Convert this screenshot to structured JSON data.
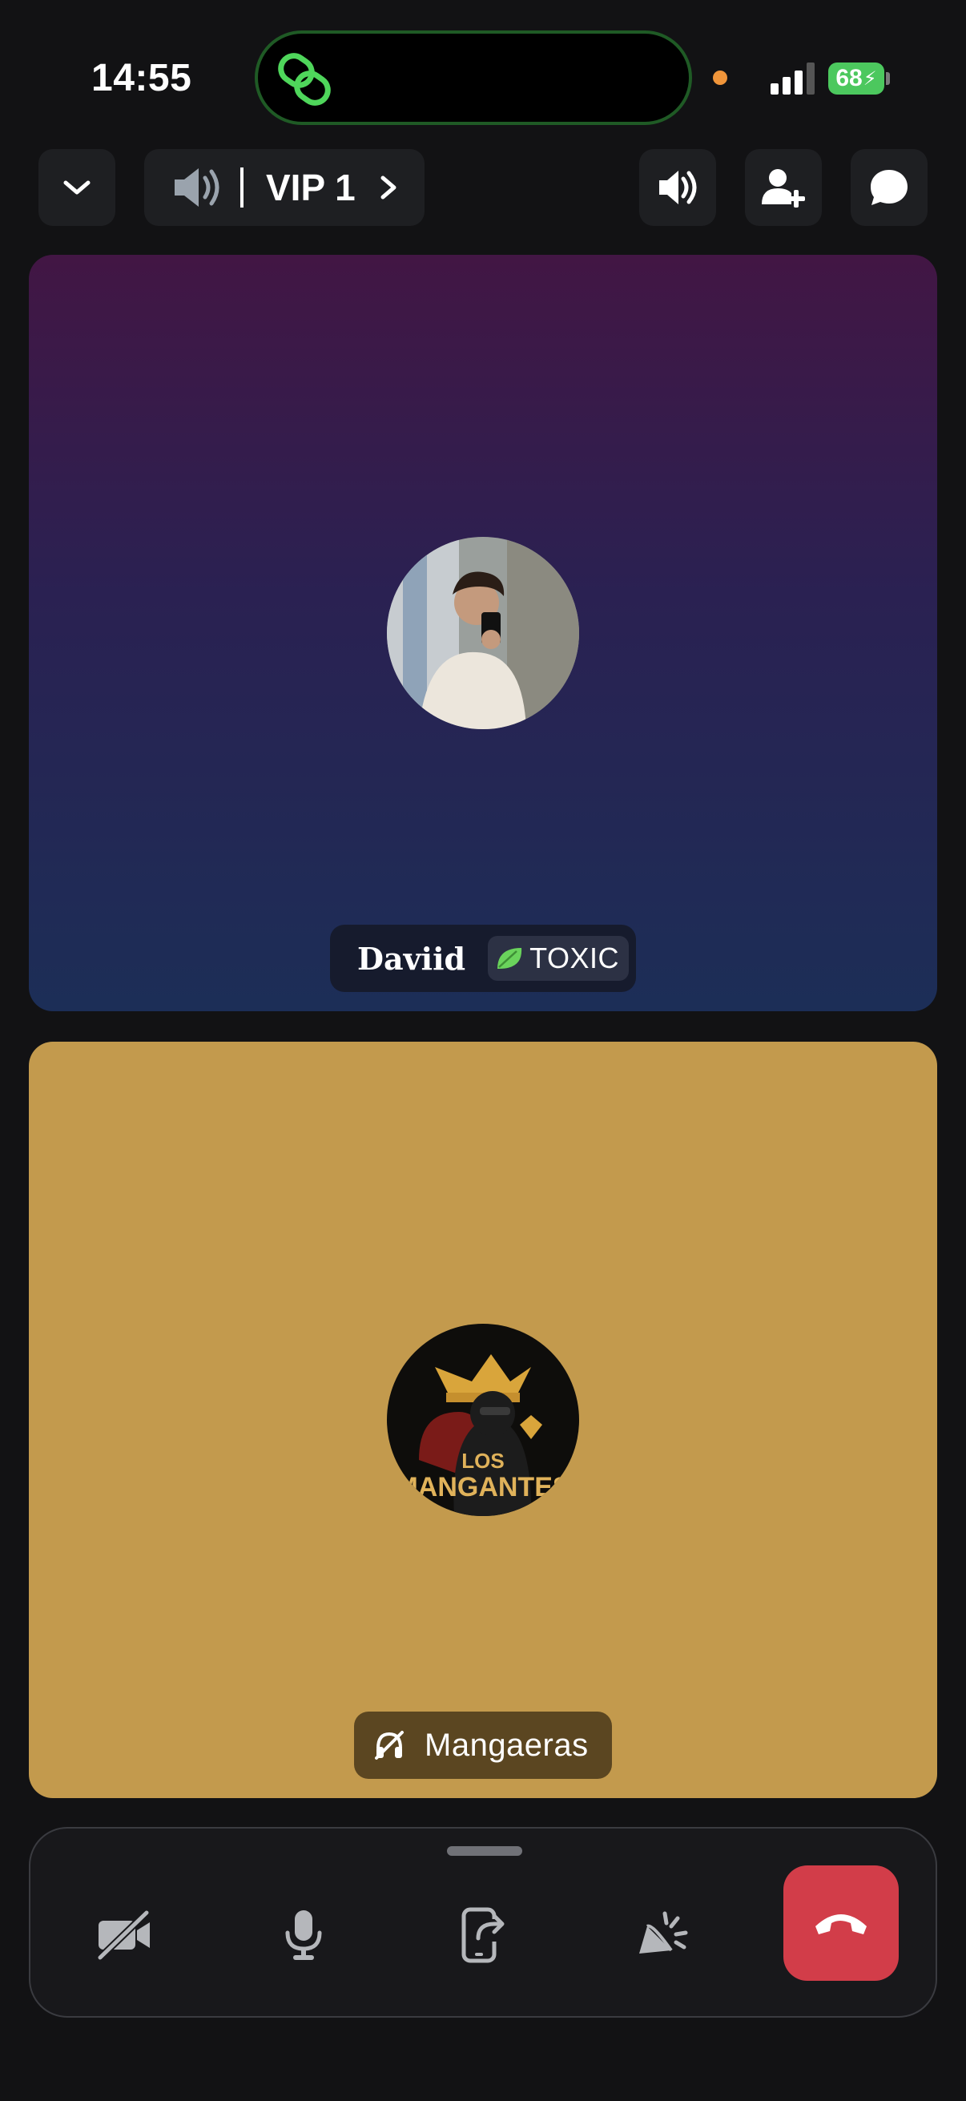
{
  "status_bar": {
    "time": "14:55",
    "battery": "68"
  },
  "top_bar": {
    "channel_name": "VIP 1"
  },
  "participants": [
    {
      "name": "Daviid",
      "tag": "TOXIC",
      "tile_color": "#2a2152"
    },
    {
      "name": "Mangaeras",
      "avatar_text": [
        "LOS",
        "MANGANTES"
      ],
      "tile_color": "#c39a4d"
    }
  ],
  "colors": {
    "end_call": "#d23d49",
    "accent_green": "#4cc85e"
  },
  "icons": [
    "chevron-down-icon",
    "speaker-icon",
    "chevron-right-icon",
    "volume-icon",
    "add-user-icon",
    "chat-icon",
    "camera-off-icon",
    "microphone-icon",
    "screen-share-icon",
    "soundboard-icon",
    "end-call-icon"
  ]
}
